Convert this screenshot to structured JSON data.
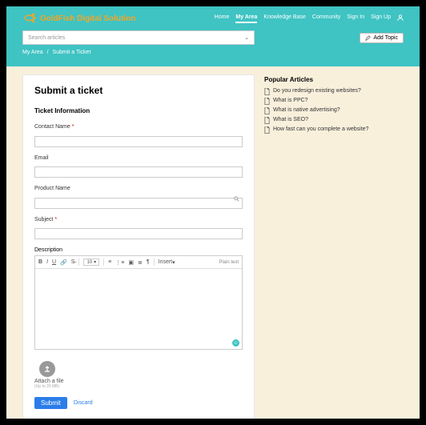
{
  "brand": "GoldFish Digital Solution",
  "nav": {
    "home": "Home",
    "myarea": "My Area",
    "kb": "Knowledge Base",
    "community": "Community",
    "signin": "Sign In",
    "signup": "Sign Up"
  },
  "search": {
    "placeholder": "Search articles"
  },
  "add_topic": "Add Topic",
  "breadcrumb": {
    "a": "My Area",
    "sep": "/",
    "b": "Submit a Ticket"
  },
  "form": {
    "title": "Submit a ticket",
    "section": "Ticket Information",
    "contact_label": "Contact Name",
    "email_label": "Email",
    "product_label": "Product Name",
    "subject_label": "Subject",
    "desc_label": "Description",
    "fontsize": "10",
    "insert": "Insert",
    "plaintext": "Plain text",
    "attach_label": "Attach a file",
    "attach_hint": "(Up to 20 MB)",
    "submit": "Submit",
    "discard": "Discard"
  },
  "sidebar": {
    "heading": "Popular Articles",
    "a1": "Do you redesign existing websites?",
    "a2": "What is PPC?",
    "a3": "What is native advertising?",
    "a4": "What is SEO?",
    "a5": "How fast can you complete a website?"
  }
}
